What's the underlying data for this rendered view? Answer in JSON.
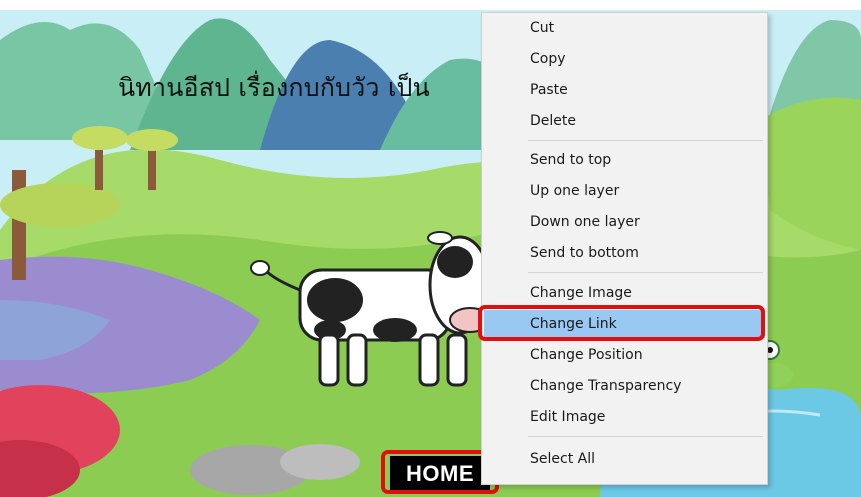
{
  "scene": {
    "title": "นิทานอีสป เรื่องกบกับวัว เป็น",
    "home_label": "HOME",
    "colors": {
      "sky": "#bfe8f3",
      "grass": "#9ad45a",
      "water": "#6cc9e6",
      "highlight": "#e10f0f"
    }
  },
  "context_menu": {
    "items": [
      {
        "label": "Cut"
      },
      {
        "label": "Copy"
      },
      {
        "label": "Paste"
      },
      {
        "label": "Delete"
      },
      {
        "label": "Send to top"
      },
      {
        "label": "Up one layer"
      },
      {
        "label": "Down one layer"
      },
      {
        "label": "Send to bottom"
      },
      {
        "label": "Change Image"
      },
      {
        "label": "Change Link",
        "selected": true
      },
      {
        "label": "Change Position"
      },
      {
        "label": "Change Transparency"
      },
      {
        "label": "Edit Image"
      },
      {
        "label": "Select All"
      }
    ],
    "selected_color": "#99c9f2"
  }
}
